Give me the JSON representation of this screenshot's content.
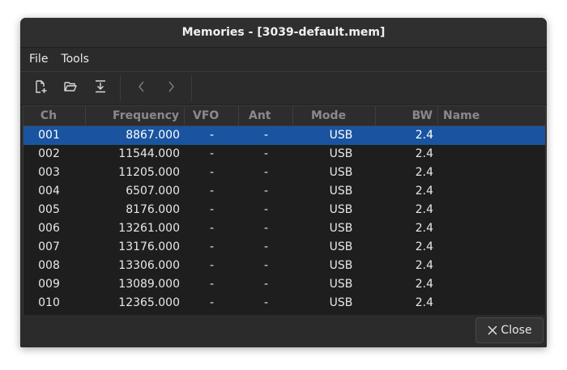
{
  "window": {
    "title": "Memories - [3039-default.mem]"
  },
  "menubar": {
    "items": [
      {
        "label": "File"
      },
      {
        "label": "Tools"
      }
    ]
  },
  "toolbar": {
    "icons": [
      "new-file-icon",
      "open-folder-icon",
      "download-icon",
      "previous-icon",
      "next-icon"
    ]
  },
  "table": {
    "columns": [
      "Ch",
      "Frequency",
      "VFO",
      "Ant",
      "Mode",
      "BW",
      "Name"
    ],
    "rows": [
      {
        "ch": "001",
        "frequency": "8867.000",
        "vfo": "-",
        "ant": "-",
        "mode": "USB",
        "bw": "2.4",
        "name": "",
        "selected": true
      },
      {
        "ch": "002",
        "frequency": "11544.000",
        "vfo": "-",
        "ant": "-",
        "mode": "USB",
        "bw": "2.4",
        "name": ""
      },
      {
        "ch": "003",
        "frequency": "11205.000",
        "vfo": "-",
        "ant": "-",
        "mode": "USB",
        "bw": "2.4",
        "name": ""
      },
      {
        "ch": "004",
        "frequency": "6507.000",
        "vfo": "-",
        "ant": "-",
        "mode": "USB",
        "bw": "2.4",
        "name": ""
      },
      {
        "ch": "005",
        "frequency": "8176.000",
        "vfo": "-",
        "ant": "-",
        "mode": "USB",
        "bw": "2.4",
        "name": ""
      },
      {
        "ch": "006",
        "frequency": "13261.000",
        "vfo": "-",
        "ant": "-",
        "mode": "USB",
        "bw": "2.4",
        "name": ""
      },
      {
        "ch": "007",
        "frequency": "13176.000",
        "vfo": "-",
        "ant": "-",
        "mode": "USB",
        "bw": "2.4",
        "name": ""
      },
      {
        "ch": "008",
        "frequency": "13306.000",
        "vfo": "-",
        "ant": "-",
        "mode": "USB",
        "bw": "2.4",
        "name": ""
      },
      {
        "ch": "009",
        "frequency": "13089.000",
        "vfo": "-",
        "ant": "-",
        "mode": "USB",
        "bw": "2.4",
        "name": ""
      },
      {
        "ch": "010",
        "frequency": "12365.000",
        "vfo": "-",
        "ant": "-",
        "mode": "USB",
        "bw": "2.4",
        "name": ""
      }
    ]
  },
  "footer": {
    "close_label": "Close",
    "close_icon": "close-icon"
  },
  "colors": {
    "selection": "#1a54a0",
    "window_bg": "#2b2b2b",
    "table_bg": "#1e1e1e",
    "header_text": "#8a8a8a"
  }
}
